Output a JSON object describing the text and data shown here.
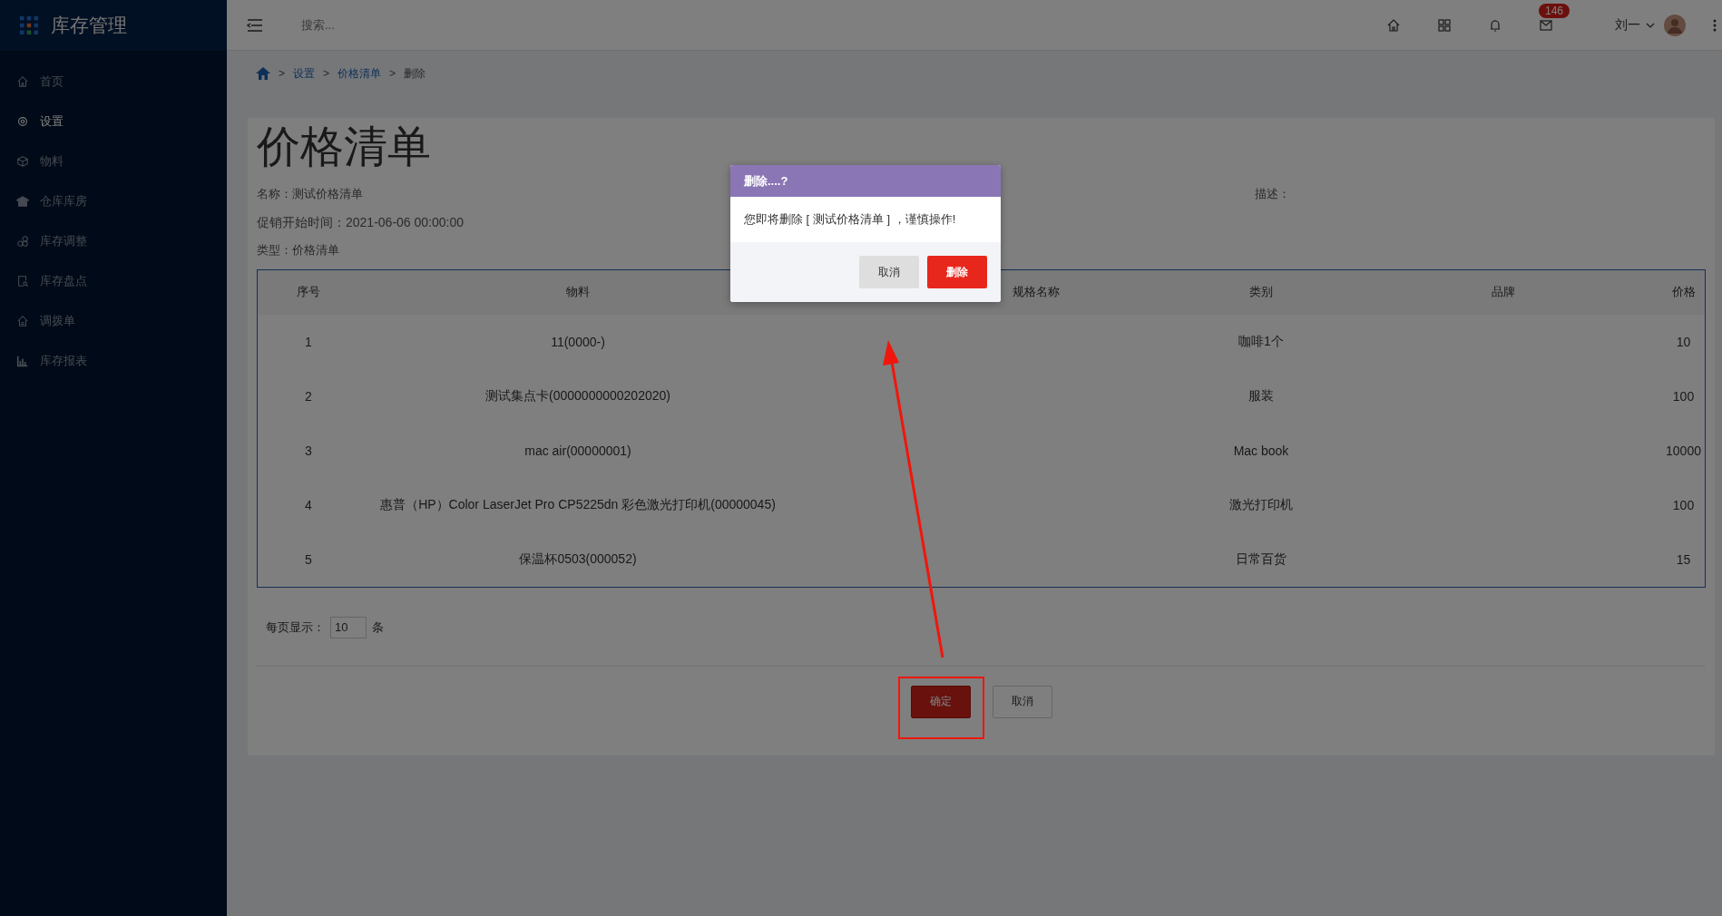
{
  "app": {
    "title": "库存管理"
  },
  "topbar": {
    "search": {
      "placeholder": "搜索..."
    },
    "badge": "146",
    "user": "刘一"
  },
  "sidebar": {
    "items": [
      {
        "label": "首页",
        "selected": false
      },
      {
        "label": "设置",
        "selected": true
      },
      {
        "label": "物料",
        "selected": false
      },
      {
        "label": "仓库库房",
        "selected": false
      },
      {
        "label": "库存调整",
        "selected": false
      },
      {
        "label": "库存盘点",
        "selected": false
      },
      {
        "label": "调拨单",
        "selected": false
      },
      {
        "label": "库存报表",
        "selected": false
      }
    ]
  },
  "breadcrumb": {
    "items": [
      {
        "label": "设置",
        "link": true
      },
      {
        "label": "价格清单",
        "link": true
      },
      {
        "label": "删除",
        "link": false
      }
    ],
    "separators": [
      ">",
      ">",
      ">"
    ]
  },
  "page": {
    "title": "价格清单",
    "fields": [
      "名称：测试价格清单",
      "促销开始时间：2021-06-06 00:00:00",
      "类型：价格清单"
    ],
    "description_label": "描述："
  },
  "table": {
    "columns": [
      "序号",
      "物料",
      "规格名称",
      "类别",
      "品牌",
      "价格"
    ],
    "rows": [
      {
        "no": "1",
        "material": "11(0000-)",
        "category": "咖啡1个",
        "price": "10"
      },
      {
        "no": "2",
        "material": "测试集点卡(0000000000202020)",
        "category": "服装",
        "price": "100"
      },
      {
        "no": "3",
        "material": "mac air(00000001)",
        "category": "Mac book",
        "price": "10000"
      },
      {
        "no": "4",
        "material": "惠普（HP）Color LaserJet Pro CP5225dn 彩色激光打印机(00000045)",
        "category": "激光打印机",
        "price": "100"
      },
      {
        "no": "5",
        "material": "保温杯0503(000052)",
        "category": "日常百货",
        "price": "15"
      }
    ]
  },
  "pagination": {
    "label": "每页显示：",
    "value": "10",
    "unit": "条"
  },
  "buttons": [
    {
      "label": "确定",
      "kind": "primary"
    },
    {
      "label": "取消",
      "kind": "default"
    }
  ],
  "dialog": {
    "title": "删除....?",
    "message": "您即将删除 [ 测试价格清单 ] ，谨慎操作!",
    "buttons": [
      {
        "label": "取消",
        "kind": "default"
      },
      {
        "label": "删除",
        "kind": "danger"
      }
    ]
  }
}
